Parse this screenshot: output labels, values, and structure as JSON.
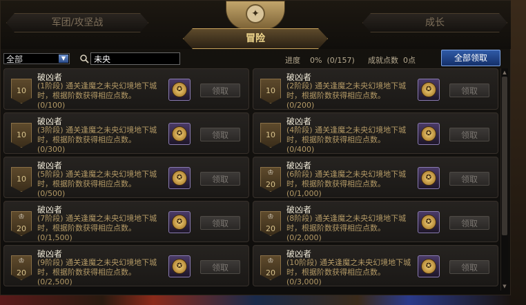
{
  "tabs": {
    "left": "军团/攻坚战",
    "active": "冒险",
    "right": "成长"
  },
  "filter": {
    "category": "全部",
    "search_value": "未央"
  },
  "stats": {
    "progress_label": "进度",
    "progress_value": "0%",
    "progress_count": "(0/157)",
    "points_label": "成就点数",
    "points_value": "0点",
    "claim_all": "全部领取"
  },
  "cards": [
    {
      "title": "破凶者",
      "desc": "(1阶段) 通关逢魔之未央幻境地下城时，根据阶数获得相应点数。",
      "progress": "(0/100)",
      "badge": "10",
      "trophy": false,
      "claim": "领取"
    },
    {
      "title": "破凶者",
      "desc": "(2阶段) 通关逢魔之未央幻境地下城时，根据阶数获得相应点数。",
      "progress": "(0/200)",
      "badge": "10",
      "trophy": false,
      "claim": "领取"
    },
    {
      "title": "破凶者",
      "desc": "(3阶段) 通关逢魔之未央幻境地下城时，根据阶数获得相应点数。",
      "progress": "(0/300)",
      "badge": "10",
      "trophy": false,
      "claim": "领取"
    },
    {
      "title": "破凶者",
      "desc": "(4阶段) 通关逢魔之未央幻境地下城时，根据阶数获得相应点数。",
      "progress": "(0/400)",
      "badge": "10",
      "trophy": false,
      "claim": "领取"
    },
    {
      "title": "破凶者",
      "desc": "(5阶段) 通关逢魔之未央幻境地下城时，根据阶数获得相应点数。",
      "progress": "(0/500)",
      "badge": "10",
      "trophy": false,
      "claim": "领取"
    },
    {
      "title": "破凶者",
      "desc": "(6阶段) 通关逢魔之未央幻境地下城时，根据阶数获得相应点数。",
      "progress": "(0/1,000)",
      "badge": "20",
      "trophy": true,
      "claim": "领取"
    },
    {
      "title": "破凶者",
      "desc": "(7阶段) 通关逢魔之未央幻境地下城时，根据阶数获得相应点数。",
      "progress": "(0/1,500)",
      "badge": "20",
      "trophy": true,
      "claim": "领取"
    },
    {
      "title": "破凶者",
      "desc": "(8阶段) 通关逢魔之未央幻境地下城时，根据阶数获得相应点数。",
      "progress": "(0/2,000)",
      "badge": "20",
      "trophy": true,
      "claim": "领取"
    },
    {
      "title": "破凶者",
      "desc": "(9阶段) 通关逢魔之未央幻境地下城时，根据阶数获得相应点数。",
      "progress": "(0/2,500)",
      "badge": "20",
      "trophy": true,
      "claim": "领取"
    },
    {
      "title": "破凶者",
      "desc": "(10阶段) 通关逢魔之未央幻境地下城时，根据阶数获得相应点数。",
      "progress": "(0/3,000)",
      "badge": "20",
      "trophy": true,
      "claim": "领取"
    }
  ],
  "icons": {
    "search": "search-icon",
    "dropdown": "chevron-down-icon",
    "trophy": "trophy-icon",
    "reward": "reward-coin-icon"
  },
  "colors": {
    "accent_gold": "#c9a35c",
    "desc_text": "#b49a66",
    "claim_all_blue": "#2f5aa6"
  }
}
